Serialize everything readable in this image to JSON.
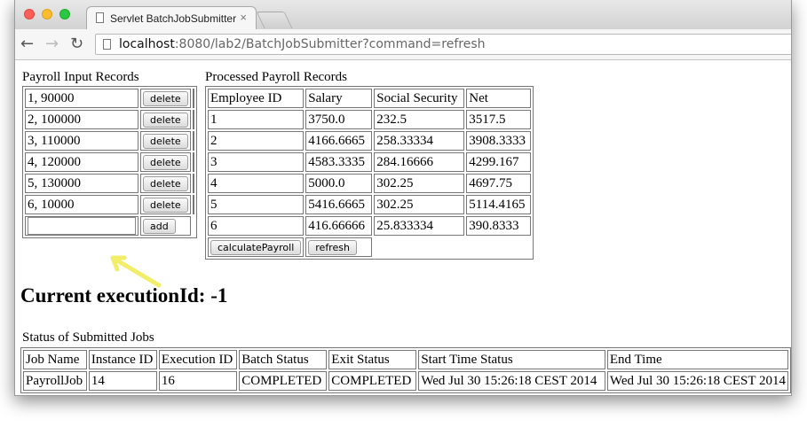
{
  "tab": {
    "title": "Servlet BatchJobSubmitter",
    "close": "×"
  },
  "toolbar": {
    "url_host": "localhost",
    "url_rest": ":8080/lab2/BatchJobSubmitter?command=refresh"
  },
  "input_records": {
    "title": "Payroll Input Records",
    "rows": [
      "1, 90000",
      "2, 100000",
      "3, 110000",
      "4, 120000",
      "5, 130000",
      "6, 10000"
    ],
    "delete_label": "delete",
    "add_label": "add",
    "new_value": ""
  },
  "processed": {
    "title": "Processed Payroll Records",
    "headers": [
      "Employee ID",
      "Salary",
      "Social Security",
      "Net"
    ],
    "rows": [
      [
        "1",
        "3750.0",
        "232.5",
        "3517.5"
      ],
      [
        "2",
        "4166.6665",
        "258.33334",
        "3908.3333"
      ],
      [
        "3",
        "4583.3335",
        "284.16666",
        "4299.167"
      ],
      [
        "4",
        "5000.0",
        "302.25",
        "4697.75"
      ],
      [
        "5",
        "5416.6665",
        "302.25",
        "5114.4165"
      ],
      [
        "6",
        "416.66666",
        "25.833334",
        "390.8333"
      ]
    ],
    "calculate_label": "calculatePayroll",
    "refresh_label": "refresh"
  },
  "execution": {
    "label": "Current executionId: -1"
  },
  "jobs": {
    "title": "Status of Submitted Jobs",
    "headers": [
      "Job Name",
      "Instance ID",
      "Execution ID",
      "Batch Status",
      "Exit Status",
      "Start Time Status",
      "End Time"
    ],
    "rows": [
      [
        "PayrollJob",
        "14",
        "16",
        "COMPLETED",
        "COMPLETED",
        "Wed Jul 30 15:26:18 CEST 2014",
        "Wed Jul 30 15:26:18 CEST 2014"
      ]
    ]
  },
  "colors": {
    "arrow": "#f2ee6a",
    "arrow_stroke": "#c9c43a"
  }
}
